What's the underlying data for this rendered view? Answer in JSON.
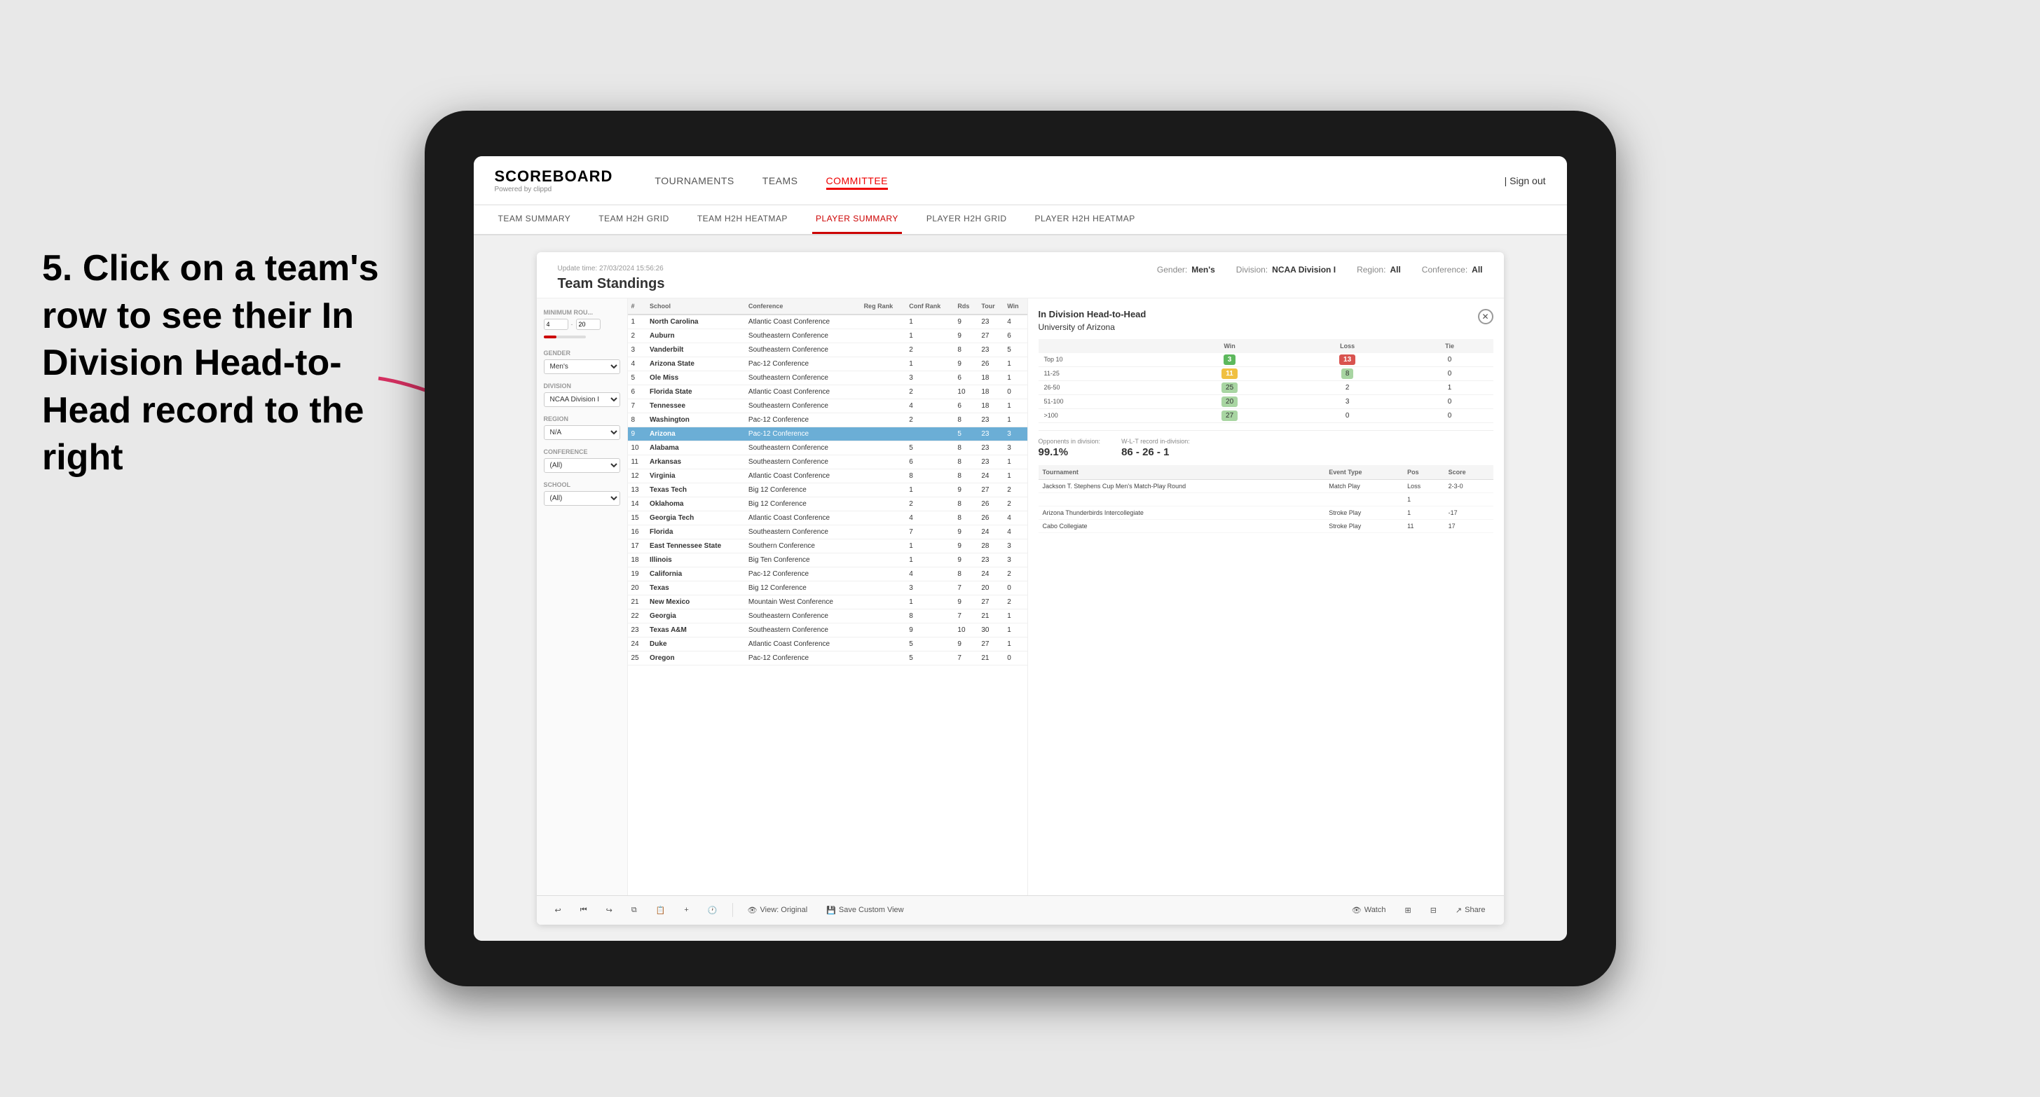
{
  "annotation": {
    "text": "5. Click on a team's row to see their In Division Head-to-Head record to the right"
  },
  "header": {
    "logo": "SCOREBOARD",
    "logo_sub": "Powered by clippd",
    "nav": [
      "TOURNAMENTS",
      "TEAMS",
      "COMMITTEE"
    ],
    "active_nav": "COMMITTEE",
    "sign_out": "Sign out"
  },
  "sub_nav": {
    "items": [
      "TEAM SUMMARY",
      "TEAM H2H GRID",
      "TEAM H2H HEATMAP",
      "PLAYER SUMMARY",
      "PLAYER H2H GRID",
      "PLAYER H2H HEATMAP"
    ],
    "active": "PLAYER SUMMARY"
  },
  "panel": {
    "update_time": "Update time: 27/03/2024 15:56:26",
    "title": "Team Standings",
    "filters_display": {
      "gender": "Men's",
      "division": "NCAA Division I",
      "region": "All",
      "conference": "All"
    }
  },
  "filters": {
    "minimum_rounds_label": "Minimum Rou...",
    "min_value": "4",
    "max_value": "20",
    "gender_label": "Gender",
    "gender_value": "Men's",
    "division_label": "Division",
    "division_value": "NCAA Division I",
    "region_label": "Region",
    "region_value": "N/A",
    "conference_label": "Conference",
    "conference_value": "(All)",
    "school_label": "School",
    "school_value": "(All)"
  },
  "table": {
    "headers": [
      "#",
      "School",
      "Conference",
      "Reg Rank",
      "Conf Rank",
      "Rds",
      "Tour",
      "Win"
    ],
    "rows": [
      {
        "rank": 1,
        "school": "North Carolina",
        "conference": "Atlantic Coast Conference",
        "reg_rank": "",
        "conf_rank": 1,
        "rds": 9,
        "tour": 23,
        "win": 4,
        "highlighted": false
      },
      {
        "rank": 2,
        "school": "Auburn",
        "conference": "Southeastern Conference",
        "reg_rank": "",
        "conf_rank": 1,
        "rds": 9,
        "tour": 27,
        "win": 6,
        "highlighted": false
      },
      {
        "rank": 3,
        "school": "Vanderbilt",
        "conference": "Southeastern Conference",
        "reg_rank": "",
        "conf_rank": 2,
        "rds": 8,
        "tour": 23,
        "win": 5,
        "highlighted": false
      },
      {
        "rank": 4,
        "school": "Arizona State",
        "conference": "Pac-12 Conference",
        "reg_rank": "",
        "conf_rank": 1,
        "rds": 9,
        "tour": 26,
        "win": 1,
        "highlighted": false
      },
      {
        "rank": 5,
        "school": "Ole Miss",
        "conference": "Southeastern Conference",
        "reg_rank": "",
        "conf_rank": 3,
        "rds": 6,
        "tour": 18,
        "win": 1,
        "highlighted": false
      },
      {
        "rank": 6,
        "school": "Florida State",
        "conference": "Atlantic Coast Conference",
        "reg_rank": "",
        "conf_rank": 2,
        "rds": 10,
        "tour": 18,
        "win": 0,
        "highlighted": false
      },
      {
        "rank": 7,
        "school": "Tennessee",
        "conference": "Southeastern Conference",
        "reg_rank": "",
        "conf_rank": 4,
        "rds": 6,
        "tour": 18,
        "win": 1,
        "highlighted": false
      },
      {
        "rank": 8,
        "school": "Washington",
        "conference": "Pac-12 Conference",
        "reg_rank": "",
        "conf_rank": 2,
        "rds": 8,
        "tour": 23,
        "win": 1,
        "highlighted": false
      },
      {
        "rank": 9,
        "school": "Arizona",
        "conference": "Pac-12 Conference",
        "reg_rank": "",
        "conf_rank": "",
        "rds": 5,
        "tour": 23,
        "win": 3,
        "highlighted": true
      },
      {
        "rank": 10,
        "school": "Alabama",
        "conference": "Southeastern Conference",
        "reg_rank": "",
        "conf_rank": 5,
        "rds": 8,
        "tour": 23,
        "win": 3,
        "highlighted": false
      },
      {
        "rank": 11,
        "school": "Arkansas",
        "conference": "Southeastern Conference",
        "reg_rank": "",
        "conf_rank": 6,
        "rds": 8,
        "tour": 23,
        "win": 1,
        "highlighted": false
      },
      {
        "rank": 12,
        "school": "Virginia",
        "conference": "Atlantic Coast Conference",
        "reg_rank": "",
        "conf_rank": 8,
        "rds": 8,
        "tour": 24,
        "win": 1,
        "highlighted": false
      },
      {
        "rank": 13,
        "school": "Texas Tech",
        "conference": "Big 12 Conference",
        "reg_rank": "",
        "conf_rank": 1,
        "rds": 9,
        "tour": 27,
        "win": 2,
        "highlighted": false
      },
      {
        "rank": 14,
        "school": "Oklahoma",
        "conference": "Big 12 Conference",
        "reg_rank": "",
        "conf_rank": 2,
        "rds": 8,
        "tour": 26,
        "win": 2,
        "highlighted": false
      },
      {
        "rank": 15,
        "school": "Georgia Tech",
        "conference": "Atlantic Coast Conference",
        "reg_rank": "",
        "conf_rank": 4,
        "rds": 8,
        "tour": 26,
        "win": 4,
        "highlighted": false
      },
      {
        "rank": 16,
        "school": "Florida",
        "conference": "Southeastern Conference",
        "reg_rank": "",
        "conf_rank": 7,
        "rds": 9,
        "tour": 24,
        "win": 4,
        "highlighted": false
      },
      {
        "rank": 17,
        "school": "East Tennessee State",
        "conference": "Southern Conference",
        "reg_rank": "",
        "conf_rank": 1,
        "rds": 9,
        "tour": 28,
        "win": 3,
        "highlighted": false
      },
      {
        "rank": 18,
        "school": "Illinois",
        "conference": "Big Ten Conference",
        "reg_rank": "",
        "conf_rank": 1,
        "rds": 9,
        "tour": 23,
        "win": 3,
        "highlighted": false
      },
      {
        "rank": 19,
        "school": "California",
        "conference": "Pac-12 Conference",
        "reg_rank": "",
        "conf_rank": 4,
        "rds": 8,
        "tour": 24,
        "win": 2,
        "highlighted": false
      },
      {
        "rank": 20,
        "school": "Texas",
        "conference": "Big 12 Conference",
        "reg_rank": "",
        "conf_rank": 3,
        "rds": 7,
        "tour": 20,
        "win": 0,
        "highlighted": false
      },
      {
        "rank": 21,
        "school": "New Mexico",
        "conference": "Mountain West Conference",
        "reg_rank": "",
        "conf_rank": 1,
        "rds": 9,
        "tour": 27,
        "win": 2,
        "highlighted": false
      },
      {
        "rank": 22,
        "school": "Georgia",
        "conference": "Southeastern Conference",
        "reg_rank": "",
        "conf_rank": 8,
        "rds": 7,
        "tour": 21,
        "win": 1,
        "highlighted": false
      },
      {
        "rank": 23,
        "school": "Texas A&M",
        "conference": "Southeastern Conference",
        "reg_rank": "",
        "conf_rank": 9,
        "rds": 10,
        "tour": 30,
        "win": 1,
        "highlighted": false
      },
      {
        "rank": 24,
        "school": "Duke",
        "conference": "Atlantic Coast Conference",
        "reg_rank": "",
        "conf_rank": 5,
        "rds": 9,
        "tour": 27,
        "win": 1,
        "highlighted": false
      },
      {
        "rank": 25,
        "school": "Oregon",
        "conference": "Pac-12 Conference",
        "reg_rank": "",
        "conf_rank": 5,
        "rds": 7,
        "tour": 21,
        "win": 0,
        "highlighted": false
      }
    ]
  },
  "h2h": {
    "title": "In Division Head-to-Head",
    "school": "University of Arizona",
    "col_headers": [
      "",
      "Win",
      "Loss",
      "Tie"
    ],
    "rows": [
      {
        "range": "Top 10",
        "win": 3,
        "loss": 13,
        "tie": 0,
        "win_color": "green",
        "loss_color": "red"
      },
      {
        "range": "11-25",
        "win": 11,
        "loss": 8,
        "tie": 0,
        "win_color": "yellow",
        "loss_color": "light_green"
      },
      {
        "range": "26-50",
        "win": 25,
        "loss": 2,
        "tie": 1,
        "win_color": "light_green",
        "loss_color": "none"
      },
      {
        "range": "51-100",
        "win": 20,
        "loss": 3,
        "tie": 0,
        "win_color": "light_green",
        "loss_color": "none"
      },
      {
        "range": ">100",
        "win": 27,
        "loss": 0,
        "tie": 0,
        "win_color": "light_green",
        "loss_color": "none"
      }
    ],
    "opponents_pct": "99.1%",
    "opponents_label": "Opponents in division:",
    "record": "86 - 26 - 1",
    "record_label": "W-L-T record in-division:",
    "tournaments": {
      "headers": [
        "Tournament",
        "Event Type",
        "Pos",
        "Score"
      ],
      "rows": [
        {
          "tournament": "Jackson T. Stephens Cup Men's Match-Play Round",
          "event_type": "Match Play",
          "pos": "Loss",
          "score": "2-3-0"
        },
        {
          "tournament": "",
          "event_type": "",
          "pos": "1",
          "score": ""
        },
        {
          "tournament": "Arizona Thunderbirds Intercollegiate",
          "event_type": "Stroke Play",
          "pos": "1",
          "score": "-17"
        },
        {
          "tournament": "Cabo Collegiate",
          "event_type": "Stroke Play",
          "pos": "11",
          "score": "17"
        }
      ]
    }
  },
  "toolbar": {
    "undo": "↩",
    "redo": "↪",
    "view_original": "View: Original",
    "save_custom": "Save Custom View",
    "watch": "Watch",
    "share": "Share"
  }
}
